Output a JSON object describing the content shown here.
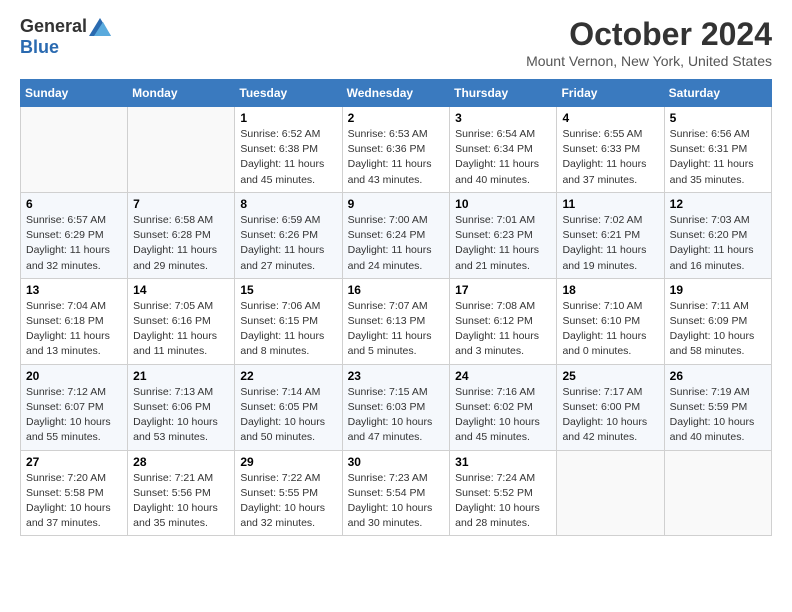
{
  "header": {
    "logo_general": "General",
    "logo_blue": "Blue",
    "month_title": "October 2024",
    "location": "Mount Vernon, New York, United States"
  },
  "days_of_week": [
    "Sunday",
    "Monday",
    "Tuesday",
    "Wednesday",
    "Thursday",
    "Friday",
    "Saturday"
  ],
  "weeks": [
    [
      {
        "day": "",
        "sunrise": "",
        "sunset": "",
        "daylight": ""
      },
      {
        "day": "",
        "sunrise": "",
        "sunset": "",
        "daylight": ""
      },
      {
        "day": "1",
        "sunrise": "Sunrise: 6:52 AM",
        "sunset": "Sunset: 6:38 PM",
        "daylight": "Daylight: 11 hours and 45 minutes."
      },
      {
        "day": "2",
        "sunrise": "Sunrise: 6:53 AM",
        "sunset": "Sunset: 6:36 PM",
        "daylight": "Daylight: 11 hours and 43 minutes."
      },
      {
        "day": "3",
        "sunrise": "Sunrise: 6:54 AM",
        "sunset": "Sunset: 6:34 PM",
        "daylight": "Daylight: 11 hours and 40 minutes."
      },
      {
        "day": "4",
        "sunrise": "Sunrise: 6:55 AM",
        "sunset": "Sunset: 6:33 PM",
        "daylight": "Daylight: 11 hours and 37 minutes."
      },
      {
        "day": "5",
        "sunrise": "Sunrise: 6:56 AM",
        "sunset": "Sunset: 6:31 PM",
        "daylight": "Daylight: 11 hours and 35 minutes."
      }
    ],
    [
      {
        "day": "6",
        "sunrise": "Sunrise: 6:57 AM",
        "sunset": "Sunset: 6:29 PM",
        "daylight": "Daylight: 11 hours and 32 minutes."
      },
      {
        "day": "7",
        "sunrise": "Sunrise: 6:58 AM",
        "sunset": "Sunset: 6:28 PM",
        "daylight": "Daylight: 11 hours and 29 minutes."
      },
      {
        "day": "8",
        "sunrise": "Sunrise: 6:59 AM",
        "sunset": "Sunset: 6:26 PM",
        "daylight": "Daylight: 11 hours and 27 minutes."
      },
      {
        "day": "9",
        "sunrise": "Sunrise: 7:00 AM",
        "sunset": "Sunset: 6:24 PM",
        "daylight": "Daylight: 11 hours and 24 minutes."
      },
      {
        "day": "10",
        "sunrise": "Sunrise: 7:01 AM",
        "sunset": "Sunset: 6:23 PM",
        "daylight": "Daylight: 11 hours and 21 minutes."
      },
      {
        "day": "11",
        "sunrise": "Sunrise: 7:02 AM",
        "sunset": "Sunset: 6:21 PM",
        "daylight": "Daylight: 11 hours and 19 minutes."
      },
      {
        "day": "12",
        "sunrise": "Sunrise: 7:03 AM",
        "sunset": "Sunset: 6:20 PM",
        "daylight": "Daylight: 11 hours and 16 minutes."
      }
    ],
    [
      {
        "day": "13",
        "sunrise": "Sunrise: 7:04 AM",
        "sunset": "Sunset: 6:18 PM",
        "daylight": "Daylight: 11 hours and 13 minutes."
      },
      {
        "day": "14",
        "sunrise": "Sunrise: 7:05 AM",
        "sunset": "Sunset: 6:16 PM",
        "daylight": "Daylight: 11 hours and 11 minutes."
      },
      {
        "day": "15",
        "sunrise": "Sunrise: 7:06 AM",
        "sunset": "Sunset: 6:15 PM",
        "daylight": "Daylight: 11 hours and 8 minutes."
      },
      {
        "day": "16",
        "sunrise": "Sunrise: 7:07 AM",
        "sunset": "Sunset: 6:13 PM",
        "daylight": "Daylight: 11 hours and 5 minutes."
      },
      {
        "day": "17",
        "sunrise": "Sunrise: 7:08 AM",
        "sunset": "Sunset: 6:12 PM",
        "daylight": "Daylight: 11 hours and 3 minutes."
      },
      {
        "day": "18",
        "sunrise": "Sunrise: 7:10 AM",
        "sunset": "Sunset: 6:10 PM",
        "daylight": "Daylight: 11 hours and 0 minutes."
      },
      {
        "day": "19",
        "sunrise": "Sunrise: 7:11 AM",
        "sunset": "Sunset: 6:09 PM",
        "daylight": "Daylight: 10 hours and 58 minutes."
      }
    ],
    [
      {
        "day": "20",
        "sunrise": "Sunrise: 7:12 AM",
        "sunset": "Sunset: 6:07 PM",
        "daylight": "Daylight: 10 hours and 55 minutes."
      },
      {
        "day": "21",
        "sunrise": "Sunrise: 7:13 AM",
        "sunset": "Sunset: 6:06 PM",
        "daylight": "Daylight: 10 hours and 53 minutes."
      },
      {
        "day": "22",
        "sunrise": "Sunrise: 7:14 AM",
        "sunset": "Sunset: 6:05 PM",
        "daylight": "Daylight: 10 hours and 50 minutes."
      },
      {
        "day": "23",
        "sunrise": "Sunrise: 7:15 AM",
        "sunset": "Sunset: 6:03 PM",
        "daylight": "Daylight: 10 hours and 47 minutes."
      },
      {
        "day": "24",
        "sunrise": "Sunrise: 7:16 AM",
        "sunset": "Sunset: 6:02 PM",
        "daylight": "Daylight: 10 hours and 45 minutes."
      },
      {
        "day": "25",
        "sunrise": "Sunrise: 7:17 AM",
        "sunset": "Sunset: 6:00 PM",
        "daylight": "Daylight: 10 hours and 42 minutes."
      },
      {
        "day": "26",
        "sunrise": "Sunrise: 7:19 AM",
        "sunset": "Sunset: 5:59 PM",
        "daylight": "Daylight: 10 hours and 40 minutes."
      }
    ],
    [
      {
        "day": "27",
        "sunrise": "Sunrise: 7:20 AM",
        "sunset": "Sunset: 5:58 PM",
        "daylight": "Daylight: 10 hours and 37 minutes."
      },
      {
        "day": "28",
        "sunrise": "Sunrise: 7:21 AM",
        "sunset": "Sunset: 5:56 PM",
        "daylight": "Daylight: 10 hours and 35 minutes."
      },
      {
        "day": "29",
        "sunrise": "Sunrise: 7:22 AM",
        "sunset": "Sunset: 5:55 PM",
        "daylight": "Daylight: 10 hours and 32 minutes."
      },
      {
        "day": "30",
        "sunrise": "Sunrise: 7:23 AM",
        "sunset": "Sunset: 5:54 PM",
        "daylight": "Daylight: 10 hours and 30 minutes."
      },
      {
        "day": "31",
        "sunrise": "Sunrise: 7:24 AM",
        "sunset": "Sunset: 5:52 PM",
        "daylight": "Daylight: 10 hours and 28 minutes."
      },
      {
        "day": "",
        "sunrise": "",
        "sunset": "",
        "daylight": ""
      },
      {
        "day": "",
        "sunrise": "",
        "sunset": "",
        "daylight": ""
      }
    ]
  ]
}
